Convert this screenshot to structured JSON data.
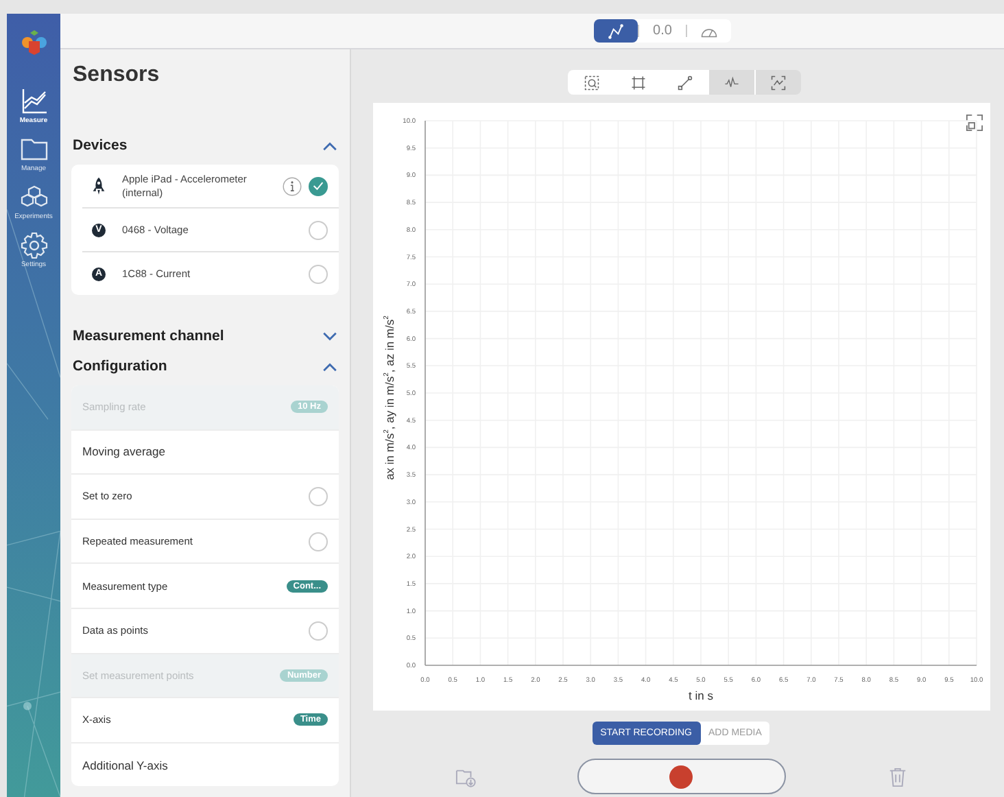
{
  "nav": [
    {
      "label": "Measure",
      "selected": true
    },
    {
      "label": "Manage",
      "selected": false
    },
    {
      "label": "Experiments",
      "selected": false
    },
    {
      "label": "Settings",
      "selected": false
    }
  ],
  "view_switch": [
    {
      "kind": "graph",
      "selected": true
    },
    {
      "kind": "value",
      "label": "0.0",
      "selected": false
    },
    {
      "kind": "gauge",
      "selected": false
    }
  ],
  "sidebar": {
    "title": "Sensors",
    "sections": [
      {
        "title": "Devices",
        "expanded": true,
        "kind": "devices"
      },
      {
        "title": "Measurement channel",
        "expanded": false
      },
      {
        "title": "Configuration",
        "expanded": true,
        "kind": "config"
      }
    ]
  },
  "devices": [
    {
      "kind": "rocket",
      "name": "Apple iPad - Accelerometer (internal)",
      "info": true,
      "selected": true
    },
    {
      "kind": "letter",
      "badge": "V",
      "name": "0468 - Voltage",
      "info": false,
      "selected": false
    },
    {
      "kind": "letter",
      "badge": "A",
      "name": "1C88 - Current",
      "info": false,
      "selected": false
    }
  ],
  "configuration": [
    {
      "kind": "badge",
      "label": "Sampling rate",
      "badge": "10 Hz",
      "disabled": true
    },
    {
      "kind": "plain",
      "label": "Moving average"
    },
    {
      "kind": "radio",
      "label": "Set to zero",
      "checked": false
    },
    {
      "kind": "radio",
      "label": "Repeated measurement",
      "checked": false
    },
    {
      "kind": "badge",
      "label": "Measurement type",
      "badge": "Cont...",
      "disabled": false
    },
    {
      "kind": "radio",
      "label": "Data as points",
      "checked": false
    },
    {
      "kind": "badge",
      "label": "Set measurement points",
      "badge": "Number",
      "disabled": true
    },
    {
      "kind": "badge",
      "label": "X-axis",
      "badge": "Time",
      "disabled": false
    },
    {
      "kind": "plain",
      "label": "Additional Y-axis"
    }
  ],
  "chart_tools": [
    {
      "kind": "zoom",
      "on": false
    },
    {
      "kind": "crop",
      "on": false
    },
    {
      "kind": "line",
      "on": false
    },
    {
      "kind": "wave",
      "on": true
    },
    {
      "kind": "fit",
      "on": true
    }
  ],
  "chart": {
    "chart_data": {
      "type": "line",
      "grid": true,
      "xlabel": "t in s",
      "ylabel": "ax in m/s$^{2}$, ay in m/s$^{2}$, az in m/s$^{2}$",
      "xlim": [
        0,
        10
      ],
      "ylim": [
        0,
        10
      ],
      "xticks": [
        {
          "value": 0,
          "label": "0.0"
        },
        {
          "value": 0.5,
          "label": "0.5"
        },
        {
          "value": 1,
          "label": "1.0"
        },
        {
          "value": 1.5,
          "label": "1.5"
        },
        {
          "value": 2,
          "label": "2.0"
        },
        {
          "value": 2.5,
          "label": "2.5"
        },
        {
          "value": 3,
          "label": "3.0"
        },
        {
          "value": 3.5,
          "label": "3.5"
        },
        {
          "value": 4,
          "label": "4.0"
        },
        {
          "value": 4.5,
          "label": "4.5"
        },
        {
          "value": 5,
          "label": "5.0"
        },
        {
          "value": 5.5,
          "label": "5.5"
        },
        {
          "value": 6,
          "label": "6.0"
        },
        {
          "value": 6.5,
          "label": "6.5"
        },
        {
          "value": 7,
          "label": "7.0"
        },
        {
          "value": 7.5,
          "label": "7.5"
        },
        {
          "value": 8,
          "label": "8.0"
        },
        {
          "value": 8.5,
          "label": "8.5"
        },
        {
          "value": 9,
          "label": "9.0"
        },
        {
          "value": 9.5,
          "label": "9.5"
        },
        {
          "value": 10,
          "label": "10.0"
        }
      ],
      "yticks": [
        {
          "value": 0,
          "label": "0.0"
        },
        {
          "value": 0.5,
          "label": "0.5"
        },
        {
          "value": 1,
          "label": "1.0"
        },
        {
          "value": 1.5,
          "label": "1.5"
        },
        {
          "value": 2,
          "label": "2.0"
        },
        {
          "value": 2.5,
          "label": "2.5"
        },
        {
          "value": 3,
          "label": "3.0"
        },
        {
          "value": 3.5,
          "label": "3.5"
        },
        {
          "value": 4,
          "label": "4.0"
        },
        {
          "value": 4.5,
          "label": "4.5"
        },
        {
          "value": 5,
          "label": "5.0"
        },
        {
          "value": 5.5,
          "label": "5.5"
        },
        {
          "value": 6,
          "label": "6.0"
        },
        {
          "value": 6.5,
          "label": "6.5"
        },
        {
          "value": 7,
          "label": "7.0"
        },
        {
          "value": 7.5,
          "label": "7.5"
        },
        {
          "value": 8,
          "label": "8.0"
        },
        {
          "value": 8.5,
          "label": "8.5"
        },
        {
          "value": 9,
          "label": "9.0"
        },
        {
          "value": 9.5,
          "label": "9.5"
        },
        {
          "value": 10,
          "label": "10.0"
        }
      ]
    }
  },
  "record_buttons": [
    {
      "label": "START RECORDING",
      "selected": true
    },
    {
      "label": "ADD MEDIA",
      "selected": false
    }
  ]
}
